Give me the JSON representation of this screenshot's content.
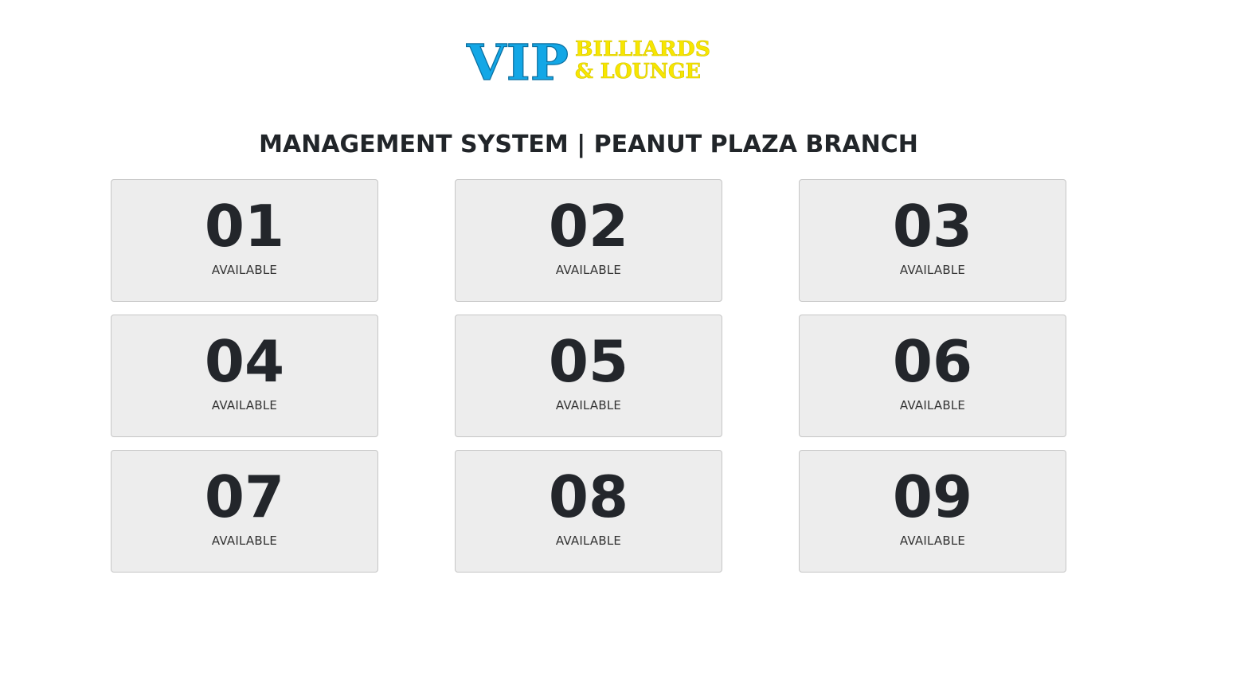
{
  "logo": {
    "main": "VIP",
    "line1": "BILLIARDS",
    "line2": "& LOUNGE",
    "main_color": "#13a7e6",
    "sub_color": "#f7e600"
  },
  "header": {
    "title": "MANAGEMENT SYSTEM | PEANUT PLAZA BRANCH"
  },
  "tables": [
    {
      "number": "01",
      "status": "AVAILABLE"
    },
    {
      "number": "02",
      "status": "AVAILABLE"
    },
    {
      "number": "03",
      "status": "AVAILABLE"
    },
    {
      "number": "04",
      "status": "AVAILABLE"
    },
    {
      "number": "05",
      "status": "AVAILABLE"
    },
    {
      "number": "06",
      "status": "AVAILABLE"
    },
    {
      "number": "07",
      "status": "AVAILABLE"
    },
    {
      "number": "08",
      "status": "AVAILABLE"
    },
    {
      "number": "09",
      "status": "AVAILABLE"
    }
  ]
}
